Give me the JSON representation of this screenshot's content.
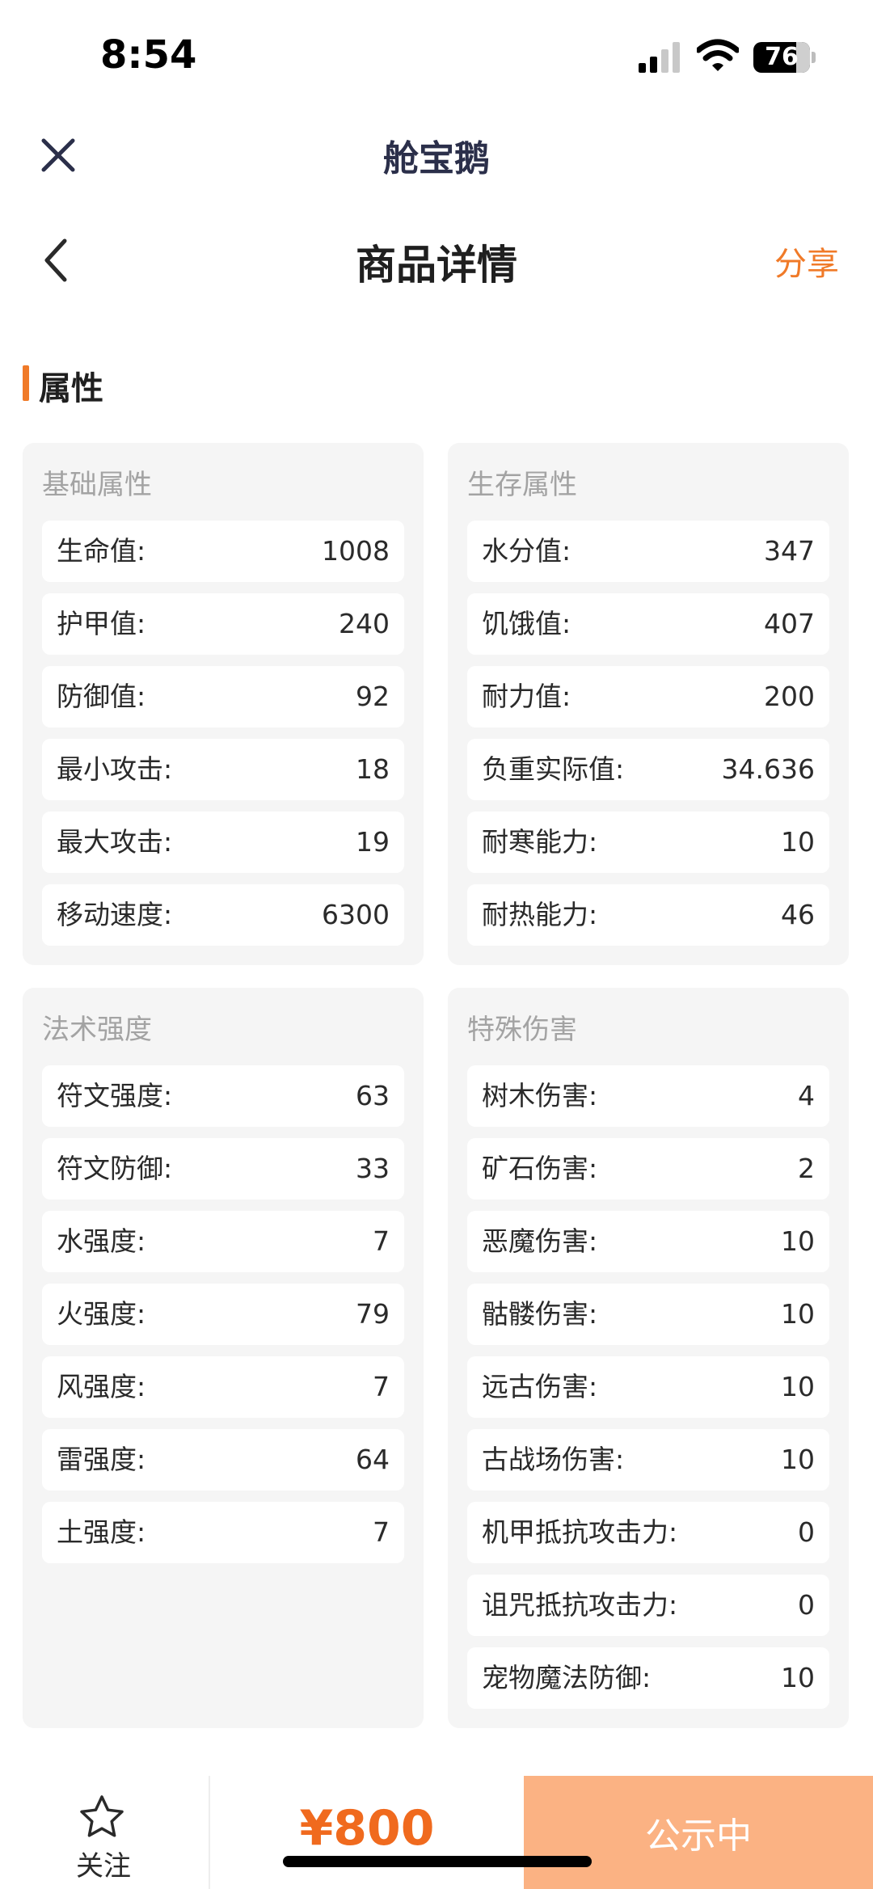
{
  "status_bar": {
    "time": "8:54",
    "battery_level": "76",
    "battery_fraction": 0.76
  },
  "mini_header": {
    "title": "舱宝鹅",
    "close_icon": "close-icon"
  },
  "page_header": {
    "title": "商品详情",
    "share_label": "分享",
    "back_icon": "chevron-left-icon"
  },
  "section": {
    "title": "属性"
  },
  "panels": {
    "basic": {
      "title": "基础属性",
      "rows": [
        {
          "label": "生命值:",
          "value": "1008"
        },
        {
          "label": "护甲值:",
          "value": "240"
        },
        {
          "label": "防御值:",
          "value": "92"
        },
        {
          "label": "最小攻击:",
          "value": "18"
        },
        {
          "label": "最大攻击:",
          "value": "19"
        },
        {
          "label": "移动速度:",
          "value": "6300"
        }
      ]
    },
    "survival": {
      "title": "生存属性",
      "rows": [
        {
          "label": "水分值:",
          "value": "347"
        },
        {
          "label": "饥饿值:",
          "value": "407"
        },
        {
          "label": "耐力值:",
          "value": "200"
        },
        {
          "label": "负重实际值:",
          "value": "34.636"
        },
        {
          "label": "耐寒能力:",
          "value": "10"
        },
        {
          "label": "耐热能力:",
          "value": "46"
        }
      ]
    },
    "spell": {
      "title": "法术强度",
      "rows": [
        {
          "label": "符文强度:",
          "value": "63"
        },
        {
          "label": "符文防御:",
          "value": "33"
        },
        {
          "label": "水强度:",
          "value": "7"
        },
        {
          "label": "火强度:",
          "value": "79"
        },
        {
          "label": "风强度:",
          "value": "7"
        },
        {
          "label": "雷强度:",
          "value": "64"
        },
        {
          "label": "土强度:",
          "value": "7"
        }
      ]
    },
    "special": {
      "title": "特殊伤害",
      "rows": [
        {
          "label": "树木伤害:",
          "value": "4"
        },
        {
          "label": "矿石伤害:",
          "value": "2"
        },
        {
          "label": "恶魔伤害:",
          "value": "10"
        },
        {
          "label": "骷髅伤害:",
          "value": "10"
        },
        {
          "label": "远古伤害:",
          "value": "10"
        },
        {
          "label": "古战场伤害:",
          "value": "10"
        },
        {
          "label": "机甲抵抗攻击力:",
          "value": "0"
        },
        {
          "label": "诅咒抵抗攻击力:",
          "value": "0"
        },
        {
          "label": "宠物魔法防御:",
          "value": "10"
        }
      ]
    }
  },
  "bottom_bar": {
    "follow_label": "关注",
    "follow_icon": "star-outline-icon",
    "price": "¥800",
    "status_button_label": "公示中"
  },
  "colors": {
    "accent": "#f07a28",
    "price": "#f06a1e",
    "status_button_bg": "#fbb283",
    "panel_bg": "#f5f5f5",
    "panel_title": "#a3a3a3"
  }
}
